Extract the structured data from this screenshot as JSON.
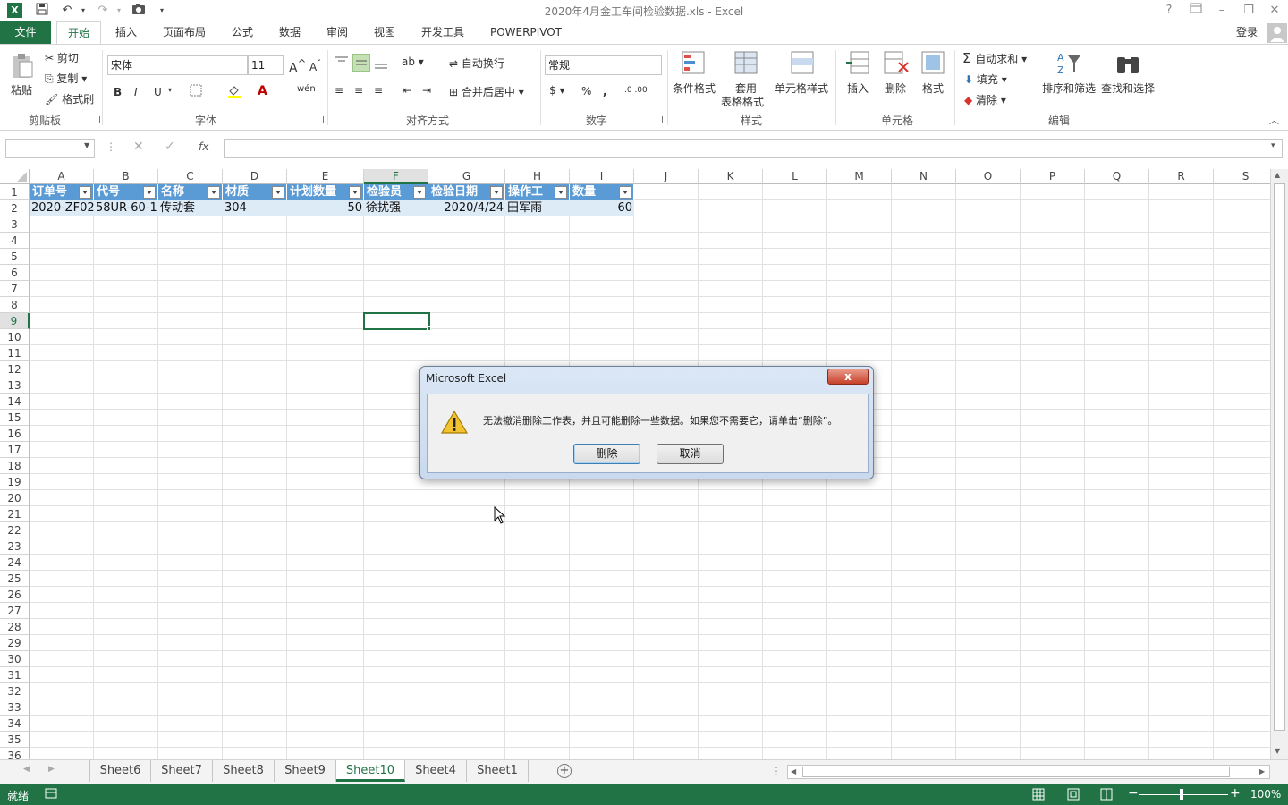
{
  "window": {
    "title": "2020年4月金工车间检验数据.xls - Excel",
    "signin": "登录",
    "help": "?",
    "qat_icons": [
      "excel-logo-icon",
      "save-icon",
      "undo-icon",
      "redo-icon",
      "camera-icon"
    ]
  },
  "tabs": [
    "文件",
    "开始",
    "插入",
    "页面布局",
    "公式",
    "数据",
    "审阅",
    "视图",
    "开发工具",
    "POWERPIVOT"
  ],
  "ribbon": {
    "clipboard": {
      "paste": "粘贴",
      "cut": "剪切",
      "copy": "复制",
      "format_painter": "格式刷",
      "label": "剪贴板"
    },
    "font": {
      "name": "宋体",
      "size": "11",
      "bold": "B",
      "italic": "I",
      "underline": "U",
      "label": "字体"
    },
    "align": {
      "wrap": "自动换行",
      "merge": "合并后居中",
      "label": "对齐方式"
    },
    "number": {
      "format": "常规",
      "percent": "%",
      "comma": ",",
      "label": "数字"
    },
    "styles": {
      "conditional": "条件格式",
      "table1": "套用",
      "table2": "表格格式",
      "cell_styles": "单元格样式",
      "label": "样式"
    },
    "cells": {
      "insert": "插入",
      "delete": "删除",
      "format": "格式",
      "label": "单元格"
    },
    "editing": {
      "autosum": "自动求和",
      "fill": "填充",
      "clear": "清除",
      "sort": "排序和筛选",
      "find": "查找和选择",
      "label": "编辑"
    }
  },
  "formula_bar": {
    "name_box": "",
    "fx": "fx",
    "formula": ""
  },
  "columns": [
    "A",
    "B",
    "C",
    "D",
    "E",
    "F",
    "G",
    "H",
    "I",
    "J",
    "K",
    "L",
    "M",
    "N",
    "O",
    "P",
    "Q",
    "R",
    "S"
  ],
  "rows": [
    "1",
    "2",
    "3",
    "4",
    "5",
    "6",
    "7",
    "8",
    "9",
    "10",
    "11",
    "12",
    "13",
    "14",
    "15",
    "16",
    "17",
    "18",
    "19",
    "20",
    "21",
    "22",
    "23",
    "24",
    "25",
    "26",
    "27",
    "28",
    "29",
    "30",
    "31",
    "32",
    "33",
    "34",
    "35",
    "36"
  ],
  "table": {
    "headers": [
      "订单号",
      "代号",
      "名称",
      "材质",
      "计划数量",
      "检验员",
      "检验日期",
      "操作工",
      "数量"
    ],
    "row": [
      "2020-ZF02",
      "58UR-60-1",
      "传动套",
      "304",
      "50",
      "徐扰强",
      "2020/4/24",
      "田军雨",
      "60"
    ]
  },
  "sheets": [
    "Sheet6",
    "Sheet7",
    "Sheet8",
    "Sheet9",
    "Sheet10",
    "Sheet4",
    "Sheet1"
  ],
  "active_sheet": "Sheet10",
  "status": {
    "ready": "就绪",
    "zoom": "100%"
  },
  "dialog": {
    "title": "Microsoft Excel",
    "close": "x",
    "message": "无法撤消删除工作表，并且可能删除一些数据。如果您不需要它，请单击“删除”。",
    "ok": "删除",
    "cancel": "取消"
  },
  "colors": {
    "excel_green": "#217346",
    "table_header": "#5b9bd5",
    "table_row": "#ddebf7"
  }
}
